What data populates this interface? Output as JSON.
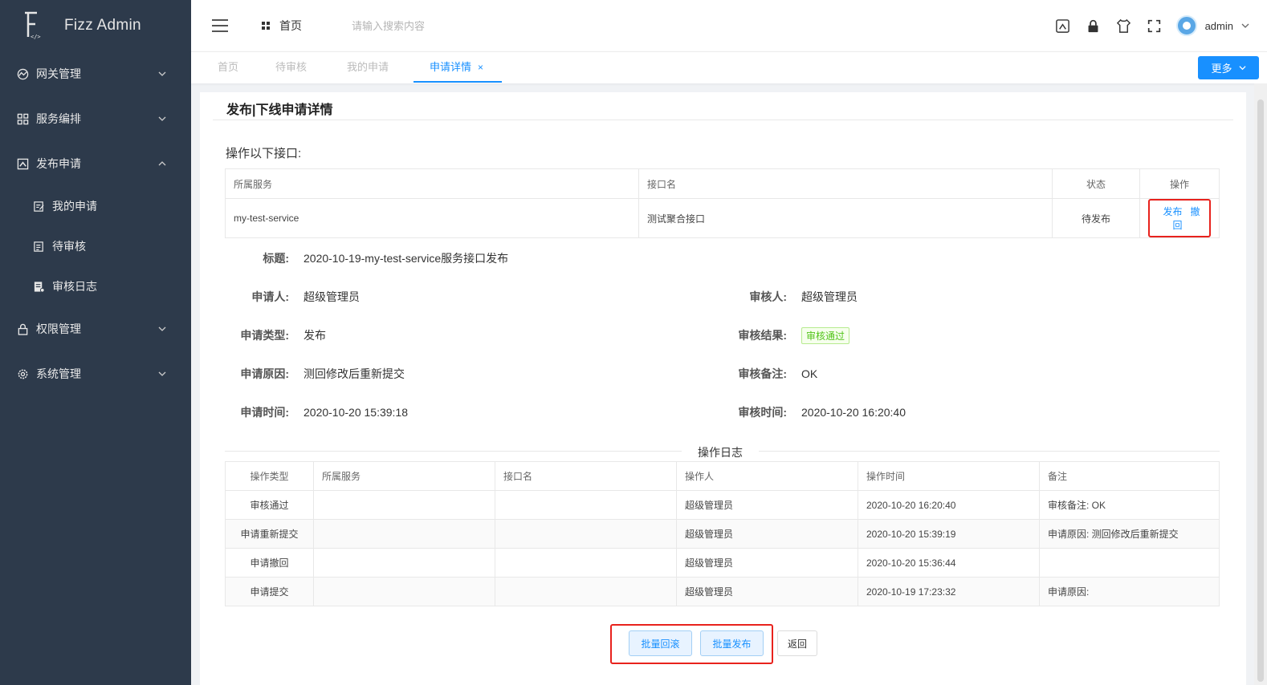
{
  "app": {
    "title": "Fizz Admin"
  },
  "sidebar": {
    "items": [
      {
        "label": "网关管理",
        "icon": "gateway-icon",
        "expanded": false
      },
      {
        "label": "服务编排",
        "icon": "grid-icon",
        "expanded": false
      },
      {
        "label": "发布申请",
        "icon": "release-icon",
        "expanded": true,
        "children": [
          {
            "label": "我的申请",
            "icon": "edit-doc-icon"
          },
          {
            "label": "待审核",
            "icon": "review-doc-icon"
          },
          {
            "label": "审核日志",
            "icon": "log-icon"
          }
        ]
      },
      {
        "label": "权限管理",
        "icon": "lock-icon",
        "expanded": false
      },
      {
        "label": "系统管理",
        "icon": "gear-icon",
        "expanded": false
      }
    ]
  },
  "header": {
    "breadcrumb": "首页",
    "search_placeholder": "请输入搜索内容",
    "user": "admin",
    "icons": [
      "screen-icon",
      "lock-icon",
      "shirt-icon",
      "fullscreen-icon"
    ]
  },
  "tabs": {
    "items": [
      "首页",
      "待审核",
      "我的申请",
      "申请详情"
    ],
    "active": "申请详情",
    "close": "×",
    "more_label": "更多"
  },
  "page": {
    "title": "发布|下线申请详情",
    "section_label": "操作以下接口:",
    "api_table": {
      "headers": [
        "所属服务",
        "接口名",
        "状态",
        "操作"
      ],
      "rows": [
        {
          "service": "my-test-service",
          "api": "测试聚合接口",
          "status": "待发布",
          "actions": [
            "发布",
            "撤回"
          ]
        }
      ]
    },
    "fields": {
      "title_label": "标题:",
      "title_value": "2020-10-19-my-test-service服务接口发布",
      "applicant_label": "申请人:",
      "applicant_value": "超级管理员",
      "reviewer_label": "审核人:",
      "reviewer_value": "超级管理员",
      "type_label": "申请类型:",
      "type_value": "发布",
      "result_label": "审核结果:",
      "result_value": "审核通过",
      "reason_label": "申请原因:",
      "reason_value": "测回修改后重新提交",
      "remark_label": "审核备注:",
      "remark_value": "OK",
      "apply_time_label": "申请时间:",
      "apply_time_value": "2020-10-20 15:39:18",
      "review_time_label": "审核时间:",
      "review_time_value": "2020-10-20 16:20:40"
    },
    "log_divider": "操作日志",
    "log_table": {
      "headers": [
        "操作类型",
        "所属服务",
        "接口名",
        "操作人",
        "操作时间",
        "备注"
      ],
      "rows": [
        [
          "审核通过",
          "",
          "",
          "超级管理员",
          "2020-10-20 16:20:40",
          "审核备注: OK"
        ],
        [
          "申请重新提交",
          "",
          "",
          "超级管理员",
          "2020-10-20 15:39:19",
          "申请原因: 测回修改后重新提交"
        ],
        [
          "申请撤回",
          "",
          "",
          "超级管理员",
          "2020-10-20 15:36:44",
          ""
        ],
        [
          "申请提交",
          "",
          "",
          "超级管理员",
          "2020-10-19 17:23:32",
          "申请原因:"
        ]
      ]
    },
    "buttons": {
      "rollback": "批量回滚",
      "publish": "批量发布",
      "back": "返回"
    }
  },
  "colors": {
    "sidebar_bg": "#2d3a4b",
    "primary": "#1890ff",
    "highlight_border": "#e8221d",
    "success": "#52c41a"
  }
}
